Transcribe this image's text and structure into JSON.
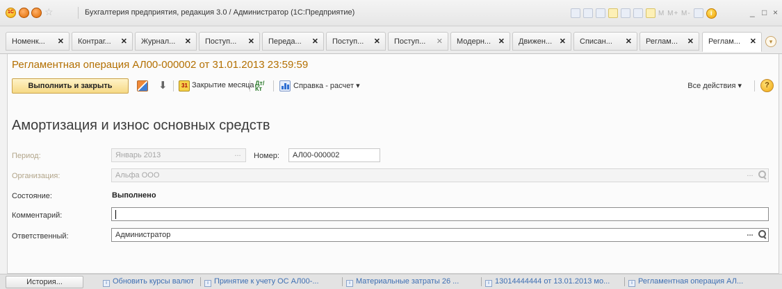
{
  "window": {
    "title": "Бухгалтерия предприятия, редакция 3.0 / Администратор  (1С:Предприятие)",
    "app_icon_text": "1С",
    "toolbar_mem_text": "M  M+  M-",
    "controls": [
      "_",
      "□",
      "×"
    ]
  },
  "tabs": [
    {
      "label": "Номенк...",
      "close": "✕"
    },
    {
      "label": "Контраг...",
      "close": "✕"
    },
    {
      "label": "Журнал...",
      "close": "✕"
    },
    {
      "label": "Поступ...",
      "close": "✕"
    },
    {
      "label": "Переда...",
      "close": "✕"
    },
    {
      "label": "Поступ...",
      "close": "✕"
    },
    {
      "label": "Поступ...",
      "close": "✕"
    },
    {
      "label": "Модерн...",
      "close": "✕"
    },
    {
      "label": "Движен...",
      "close": "✕"
    },
    {
      "label": "Списан...",
      "close": "✕"
    },
    {
      "label": "Реглам...",
      "close": "✕"
    },
    {
      "label": "Реглам...",
      "close": "✕",
      "active": true
    }
  ],
  "document": {
    "title": "Регламентная операция АЛ00-000002 от 31.01.2013 23:59:59",
    "toolbar": {
      "execute_close": "Выполнить и закрыть",
      "month_close": "Закрытие месяца",
      "dt_kt_icon": "Дт/Кт",
      "report_calc": "Справка - расчет ▾",
      "all_actions": "Все действия ▾",
      "help": "?"
    },
    "section_title": "Амортизация и износ основных средств",
    "form": {
      "period_label": "Период:",
      "period_value": "Январь 2013",
      "period_btn": "...",
      "number_label": "Номер:",
      "number_value": "АЛ00-000002",
      "org_label": "Организация:",
      "org_value": "Альфа ООО",
      "org_btn": "...",
      "state_label": "Состояние:",
      "state_value": "Выполнено",
      "comment_label": "Комментарий:",
      "comment_value": "",
      "responsible_label": "Ответственный:",
      "responsible_value": "Администратор",
      "responsible_btn": "..."
    }
  },
  "history": {
    "button": "История...",
    "items": [
      "Обновить курсы валют",
      "Принятие к учету ОС АЛ00-...",
      "Материальные затраты 26 ...",
      "13014444444 от 13.01.2013 мо...",
      "Регламентная операция АЛ..."
    ]
  }
}
